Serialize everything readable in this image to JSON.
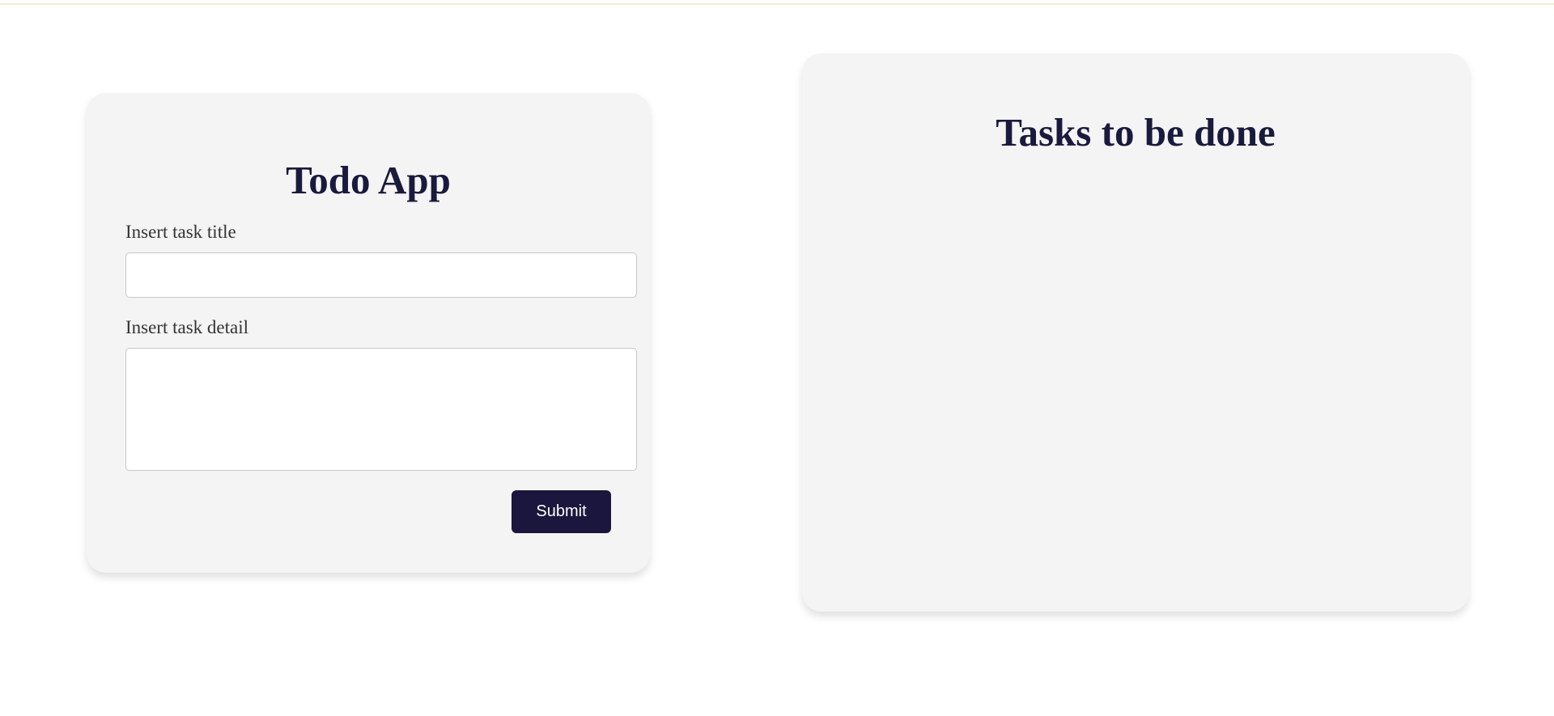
{
  "app": {
    "title": "Todo App"
  },
  "form": {
    "title_label": "Insert task title",
    "title_value": "",
    "title_placeholder": "",
    "detail_label": "Insert task detail",
    "detail_value": "",
    "detail_placeholder": "",
    "submit_label": "Submit"
  },
  "tasks": {
    "heading": "Tasks to be done",
    "items": []
  },
  "colors": {
    "accent": "#1a163d",
    "card_background": "#f4f4f4",
    "heading": "#1a1a3d"
  }
}
